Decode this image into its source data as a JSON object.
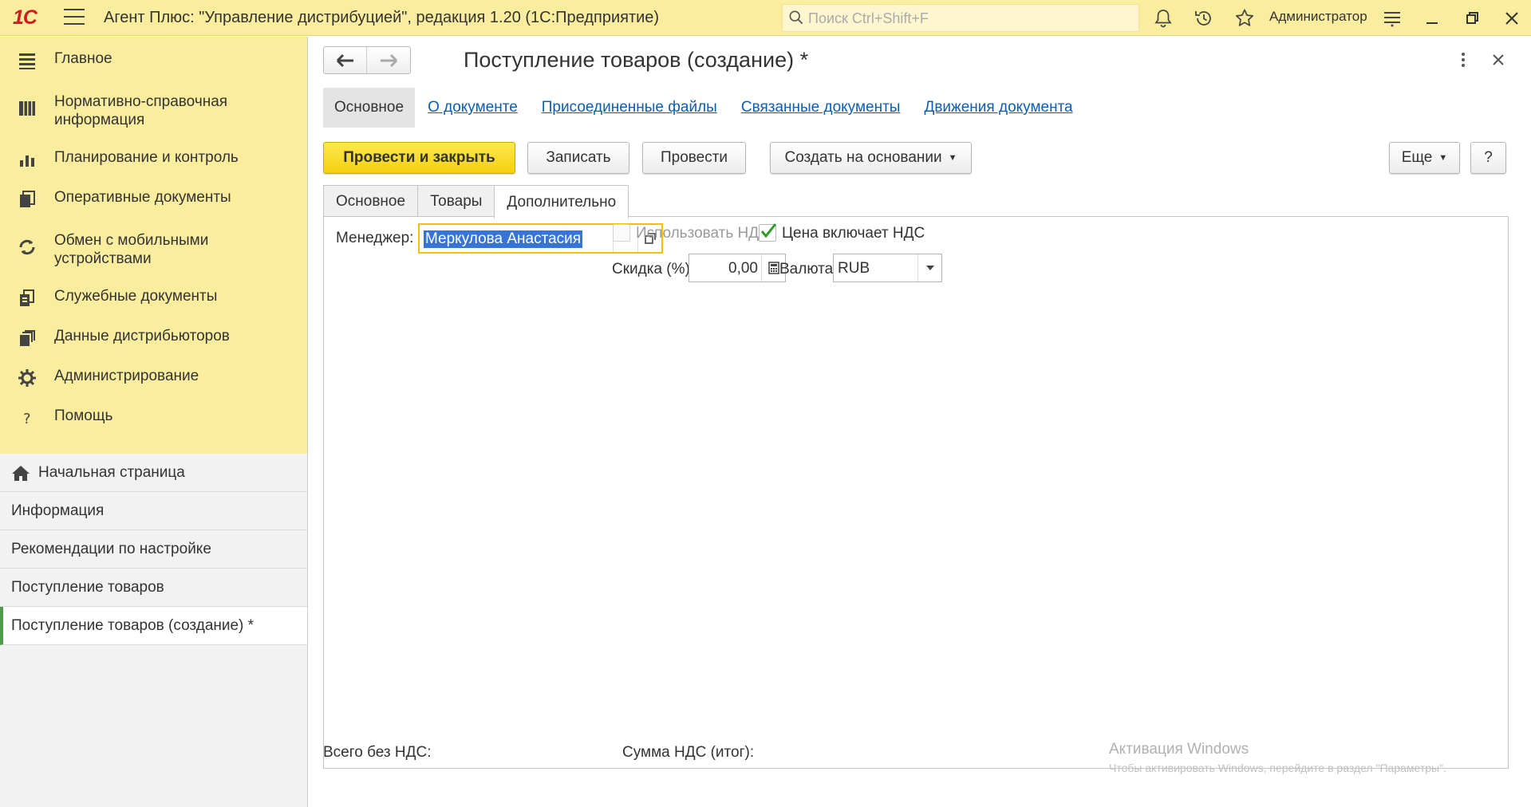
{
  "app": {
    "logo": "1С",
    "title": "Агент Плюс: \"Управление дистрибуцией\", редакция 1.20  (1С:Предприятие)",
    "search_placeholder": "Поиск Ctrl+Shift+F",
    "user": "Администратор"
  },
  "sidebar": {
    "sections": [
      {
        "label": "Главное",
        "icon": "list-icon"
      },
      {
        "label": "Нормативно-справочная информация",
        "icon": "reference-book-icon"
      },
      {
        "label": "Планирование и контроль",
        "icon": "bar-chart-icon"
      },
      {
        "label": "Оперативные документы",
        "icon": "documents-icon"
      },
      {
        "label": "Обмен с мобильными устройствами",
        "icon": "sync-icon"
      },
      {
        "label": "Служебные документы",
        "icon": "service-docs-icon"
      },
      {
        "label": "Данные дистрибьюторов",
        "icon": "distributor-data-icon"
      },
      {
        "label": "Администрирование",
        "icon": "gear-icon"
      },
      {
        "label": "Помощь",
        "icon": "help-icon"
      }
    ],
    "open_windows": [
      {
        "label": "Начальная страница"
      },
      {
        "label": "Информация"
      },
      {
        "label": "Рекомендации по настройке"
      },
      {
        "label": "Поступление товаров"
      },
      {
        "label": "Поступление товаров (создание) *"
      }
    ]
  },
  "form": {
    "title": "Поступление товаров (создание) *",
    "link_tabs": [
      "Основное",
      "О документе",
      "Присоединенные файлы",
      "Связанные документы",
      "Движения документа"
    ],
    "commands": {
      "post_close": "Провести и закрыть",
      "save": "Записать",
      "post": "Провести",
      "create_based": "Создать на основании",
      "more": "Еще",
      "help": "?"
    },
    "tabs": [
      "Основное",
      "Товары",
      "Дополнительно"
    ],
    "active_tab": "Дополнительно",
    "fields": {
      "manager_label": "Менеджер:",
      "manager_value": "Меркулова Анастасия",
      "use_vat_label": "Использовать НДС",
      "use_vat_checked": false,
      "price_incl_vat_label": "Цена включает НДС",
      "price_incl_vat_checked": true,
      "discount_label": "Скидка (%):",
      "discount_value": "0,00",
      "currency_label": "Валюта:",
      "currency_value": "RUB"
    },
    "footer": {
      "total_no_vat_label": "Всего без НДС:",
      "vat_total_label": "Сумма НДС (итог):"
    }
  },
  "watermark": {
    "line1": "Активация Windows",
    "line2": "Чтобы активировать Windows, перейдите в раздел \"Параметры\"."
  },
  "colors": {
    "titlebar_bg": "#fbed9e",
    "primary_button": "#f5d60f",
    "link": "#0b5fb3",
    "active_accent": "#4a9e48"
  }
}
